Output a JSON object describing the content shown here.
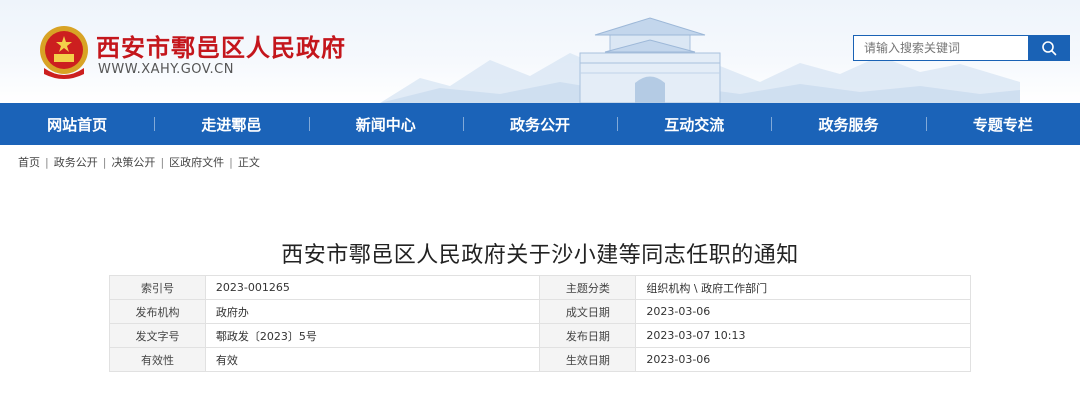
{
  "header": {
    "site_title": "西安市鄠邑区人民政府",
    "site_url": "WWW.XAHY.GOV.CN",
    "search_placeholder": "请输入搜索关键词",
    "search_icon": "search-icon",
    "brand_color": "#1b63b8",
    "title_color": "#c4161c"
  },
  "nav": {
    "items": [
      "网站首页",
      "走进鄠邑",
      "新闻中心",
      "政务公开",
      "互动交流",
      "政务服务",
      "专题专栏"
    ]
  },
  "breadcrumb": [
    "首页",
    "政务公开",
    "决策公开",
    "区政府文件",
    "正文"
  ],
  "article": {
    "title": "西安市鄠邑区人民政府关于沙小建等同志任职的通知",
    "meta": [
      {
        "k1": "索引号",
        "v1": "2023-001265",
        "k2": "主题分类",
        "v2": "组织机构 \\ 政府工作部门"
      },
      {
        "k1": "发布机构",
        "v1": "政府办",
        "k2": "成文日期",
        "v2": "2023-03-06"
      },
      {
        "k1": "发文字号",
        "v1": "鄠政发〔2023〕5号",
        "k2": "发布日期",
        "v2": "2023-03-07 10:13"
      },
      {
        "k1": "有效性",
        "v1": "有效",
        "k2": "生效日期",
        "v2": "2023-03-06"
      }
    ]
  }
}
